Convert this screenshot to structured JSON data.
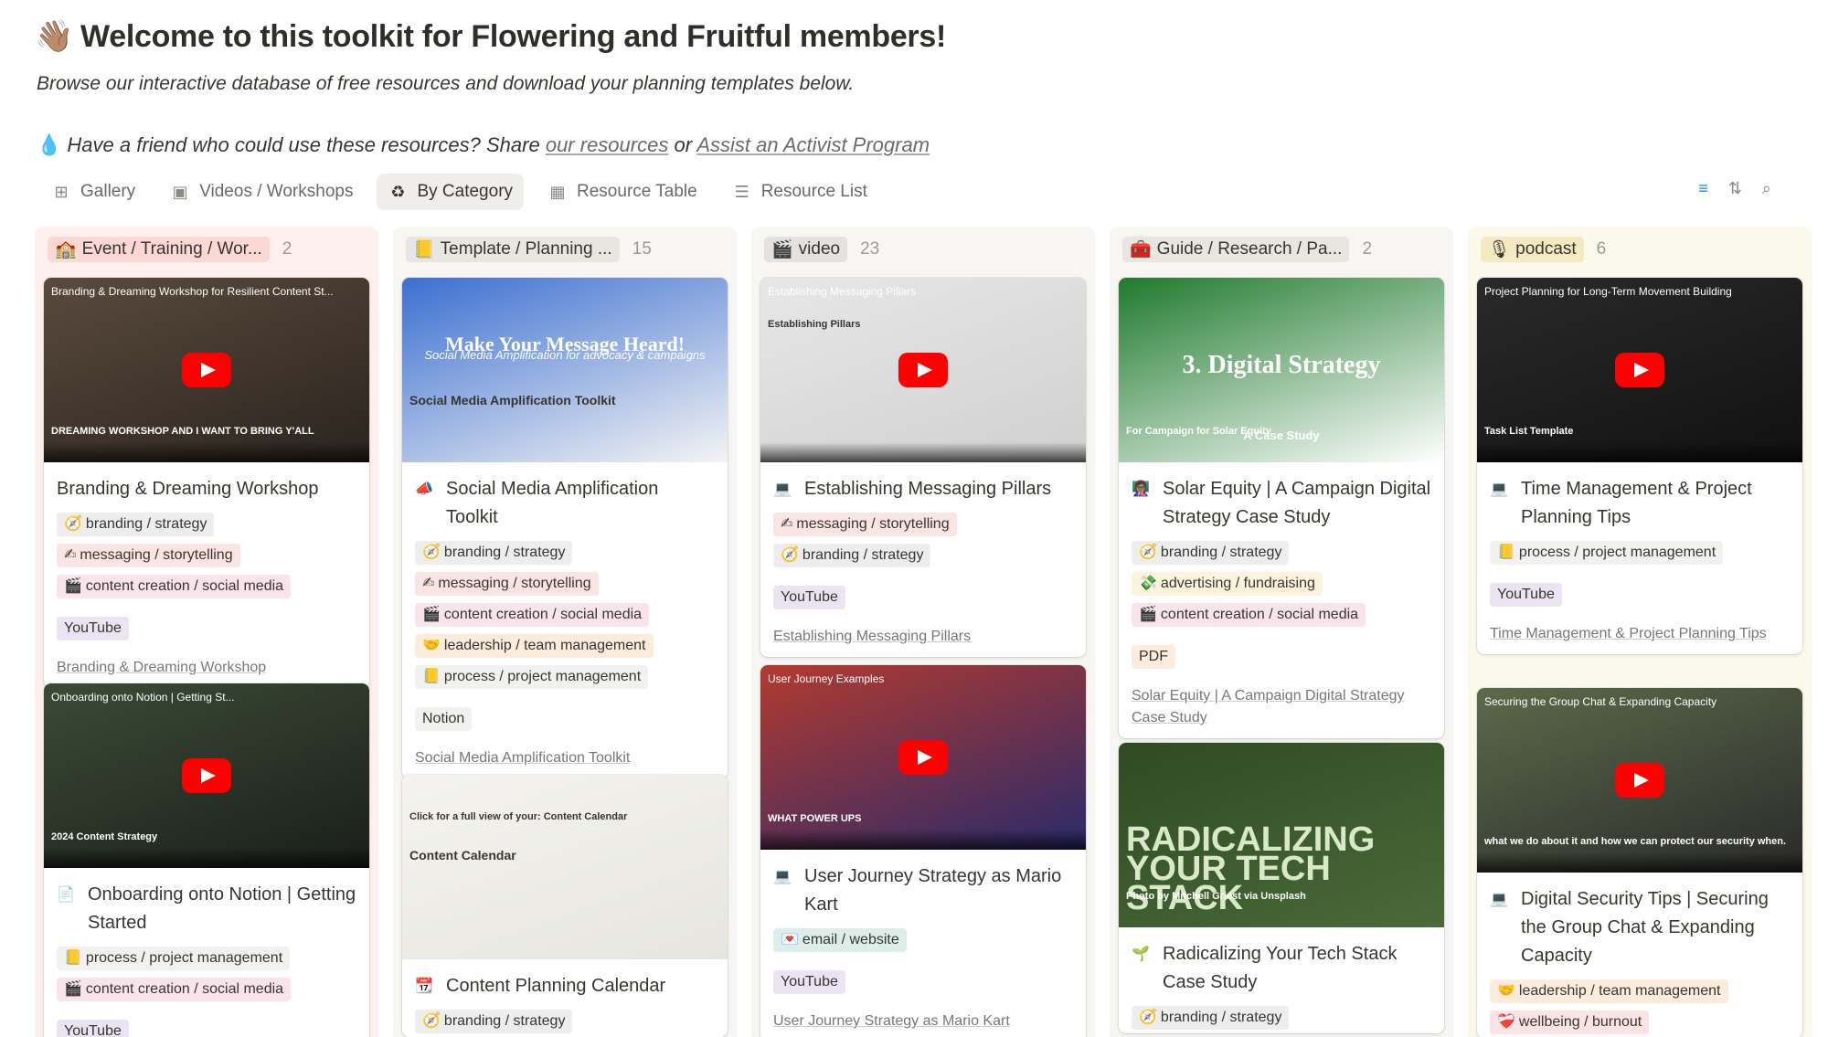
{
  "header": {
    "wave": "👋🏽",
    "title": "Welcome to this toolkit for Flowering and Fruitful members!",
    "subtitle": "Browse our interactive database of free resources and download your planning templates below.",
    "share_prefix": "Have a friend who could use these resources? Share ",
    "share_link1": "our resources",
    "share_mid": " or ",
    "share_link2": "Assist an Activist Program"
  },
  "tabs": [
    {
      "label": "Gallery",
      "icon": "gallery-icon"
    },
    {
      "label": "Videos / Workshops",
      "icon": "video-icon"
    },
    {
      "label": "By Category",
      "icon": "recycle-icon"
    },
    {
      "label": "Resource Table",
      "icon": "table-icon"
    },
    {
      "label": "Resource List",
      "icon": "list-icon"
    }
  ],
  "colors": {
    "accent": "#2383e2",
    "youtube_red": "#ff0000"
  },
  "columns": [
    {
      "label": "Event / Training / Wor...",
      "count": "2",
      "icon": "🏫",
      "bg": "#fdf0ee",
      "pill": "#fbd8d3",
      "cards": [
        {
          "title": "Branding & Dreaming Workshop",
          "icon": "",
          "tags": [
            [
              "branding / strategy",
              "t-brand",
              "🧭"
            ],
            [
              "messaging / storytelling",
              "t-msg",
              "✍"
            ],
            [
              "content creation / social media",
              "t-content",
              "🎬"
            ]
          ],
          "type": "YouTube",
          "type_class": "t-yt",
          "foot": "Branding & Dreaming Workshop",
          "thumb_text": "Branding & Dreaming Workshop for Resilient Content St...",
          "thumb_caption": "DREAMING WORKSHOP AND I WANT TO BRING Y'ALL"
        },
        {
          "title": "Onboarding onto Notion | Getting Started",
          "icon": "📄",
          "tags": [
            [
              "process / project management",
              "t-proc",
              "📒"
            ],
            [
              "content creation / social media",
              "t-content",
              "🎬"
            ]
          ],
          "type": "YouTube",
          "type_class": "t-yt",
          "foot": "",
          "thumb_text": "Onboarding onto Notion | Getting St...",
          "thumb_caption": "2024 Content Strategy"
        }
      ]
    },
    {
      "label": "Template / Planning ...",
      "count": "15",
      "icon": "📒",
      "bg": "#f7f6f3",
      "pill": "#e8e6e1",
      "cards": [
        {
          "title": "Social Media Amplification Toolkit",
          "icon": "📣",
          "tags": [
            [
              "branding / strategy",
              "t-brand",
              "🧭"
            ],
            [
              "messaging / storytelling",
              "t-msg",
              "✍"
            ],
            [
              "content creation / social media",
              "t-content",
              "🎬"
            ],
            [
              "leadership / team management",
              "t-lead",
              "🤝"
            ],
            [
              "process / project management",
              "t-proc",
              "📒"
            ]
          ],
          "type": "Notion",
          "type_class": "t-notion",
          "foot": "Social Media Amplification Toolkit",
          "thumb_text": "Make Your Message Heard!",
          "thumb_caption": "Social Media Amplification Toolkit",
          "thumb_sub": "Social Media Amplification for advocacy & campaigns"
        },
        {
          "title": "Content Planning Calendar",
          "icon": "📆",
          "tags": [
            [
              "branding / strategy",
              "t-brand",
              "🧭"
            ]
          ],
          "type": "",
          "type_class": "",
          "foot": "",
          "thumb_text": "Content Calendar",
          "thumb_caption": "Click for a full view of your: Content Calendar"
        }
      ]
    },
    {
      "label": "video",
      "count": "23",
      "icon": "🎬",
      "bg": "#f7f6f3",
      "pill": "#e3e2e0",
      "cards": [
        {
          "title": "Establishing Messaging Pillars",
          "icon": "💻",
          "tags": [
            [
              "messaging / storytelling",
              "t-msg",
              "✍"
            ],
            [
              "branding / strategy",
              "t-brand",
              "🧭"
            ]
          ],
          "type": "YouTube",
          "type_class": "t-yt",
          "foot": "Establishing Messaging Pillars",
          "thumb_text": "Establishing Messaging Pillars",
          "thumb_caption": "Establishing Pillars"
        },
        {
          "title": "User Journey Strategy as Mario Kart",
          "icon": "💻",
          "tags": [
            [
              "email / website",
              "t-email",
              "💌"
            ]
          ],
          "type": "YouTube",
          "type_class": "t-yt",
          "foot": "User Journey Strategy as Mario Kart",
          "thumb_text": "User Journey Examples",
          "thumb_caption": "WHAT POWER UPS"
        }
      ]
    },
    {
      "label": "Guide / Research / Pa...",
      "count": "2",
      "icon": "🧰",
      "bg": "#f7f6f3",
      "pill": "#e8e6e1",
      "cards": [
        {
          "title": "Solar Equity | A Campaign Digital Strategy Case Study",
          "icon": "👩🏽‍🏫",
          "tags": [
            [
              "branding / strategy",
              "t-brand",
              "🧭"
            ],
            [
              "advertising / fundraising",
              "t-adv",
              "💸"
            ],
            [
              "content creation / social media",
              "t-content",
              "🎬"
            ]
          ],
          "type": "PDF",
          "type_class": "t-pdf",
          "foot": "Solar Equity | A Campaign Digital Strategy Case Study",
          "thumb_text": "3. Digital Strategy",
          "thumb_caption": "For Campaign for Solar Equity",
          "thumb_sub": "A Case Study"
        },
        {
          "title": "Radicalizing Your Tech Stack Case Study",
          "icon": "🌱",
          "tags": [
            [
              "branding / strategy",
              "t-brand",
              "🧭"
            ]
          ],
          "type": "",
          "type_class": "",
          "foot": "",
          "thumb_text": "RADICALIZING YOUR TECH STACK",
          "thumb_caption": "Photo by Mitchell Griest via Unsplash"
        }
      ]
    },
    {
      "label": "podcast",
      "count": "6",
      "icon": "🎙",
      "bg": "#fbf8ec",
      "pill": "#f4e9c1",
      "cards": [
        {
          "title": "Time Management & Project Planning Tips",
          "icon": "💻",
          "tags": [
            [
              "process / project management",
              "t-proc",
              "📒"
            ]
          ],
          "type": "YouTube",
          "type_class": "t-yt",
          "foot": "Time Management & Project Planning Tips",
          "thumb_text": "Project Planning for Long-Term Movement Building",
          "thumb_caption": "Task List Template"
        },
        {
          "title": "Digital Security Tips | Securing the Group Chat & Expanding Capacity",
          "icon": "💻",
          "tags": [
            [
              "leadership / team management",
              "t-lead",
              "🤝"
            ],
            [
              "wellbeing / burnout",
              "t-well",
              "❤️‍🩹"
            ]
          ],
          "type": "",
          "type_class": "",
          "foot": "",
          "thumb_text": "Securing the Group Chat & Expanding Capacity",
          "thumb_caption": "what we do about it and how we can protect our security when."
        }
      ]
    }
  ]
}
